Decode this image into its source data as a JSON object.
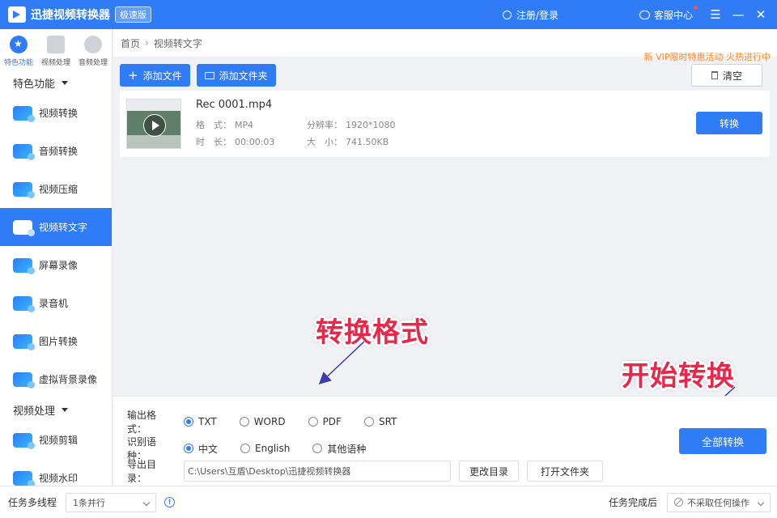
{
  "titlebar": {
    "app_title": "迅捷视频转换器",
    "edition": "极速版",
    "login": "注册/登录",
    "service": "客服中心"
  },
  "nav": {
    "topcats": [
      {
        "label": "特色功能"
      },
      {
        "label": "视频处理"
      },
      {
        "label": "音频处理"
      }
    ],
    "section1": "特色功能",
    "items": [
      {
        "label": "视频转换"
      },
      {
        "label": "音频转换"
      },
      {
        "label": "视频压缩"
      },
      {
        "label": "视频转文字"
      },
      {
        "label": "屏幕录像"
      },
      {
        "label": "录音机"
      },
      {
        "label": "图片转换"
      },
      {
        "label": "虚拟背景录像"
      }
    ],
    "section2": "视频处理",
    "items2": [
      {
        "label": "视频剪辑"
      },
      {
        "label": "视频水印"
      }
    ]
  },
  "breadcrumb": {
    "home": "首页",
    "current": "视频转文字"
  },
  "promo": "新 VIP限时特惠活动 火热进行中",
  "toolbar": {
    "add_file": "添加文件",
    "add_folder": "添加文件夹",
    "clear": "清空"
  },
  "file": {
    "name": "Rec 0001.mp4",
    "format_label": "格　式：",
    "format": "MP4",
    "duration_label": "时　长：",
    "duration": "00:00:03",
    "resolution_label": "分辨率：",
    "resolution": "1920*1080",
    "size_label": "大　小：",
    "size": "741.50KB",
    "convert": "转换"
  },
  "annotations": {
    "format": "转换格式",
    "start": "开始转换"
  },
  "settings": {
    "output_format_label": "输出格式：",
    "formats": [
      {
        "label": "TXT",
        "selected": true
      },
      {
        "label": "WORD",
        "selected": false
      },
      {
        "label": "PDF",
        "selected": false
      },
      {
        "label": "SRT",
        "selected": false
      }
    ],
    "language_label": "识别语种：",
    "languages": [
      {
        "label": "中文",
        "selected": true
      },
      {
        "label": "English",
        "selected": false
      },
      {
        "label": "其他语种",
        "selected": false
      }
    ],
    "dir_label": "导出目录：",
    "dir_value": "C:\\Users\\互盾\\Desktop\\迅捷视频转换器",
    "change_dir": "更改目录",
    "open_folder": "打开文件夹",
    "convert_all": "全部转换"
  },
  "statusbar": {
    "threads_label": "任务多线程",
    "threads_value": "1条并行",
    "after_label": "任务完成后",
    "after_value": "不采取任何操作"
  },
  "colors": {
    "accent": "#2f7cf6",
    "annotation": "#e6294a"
  }
}
